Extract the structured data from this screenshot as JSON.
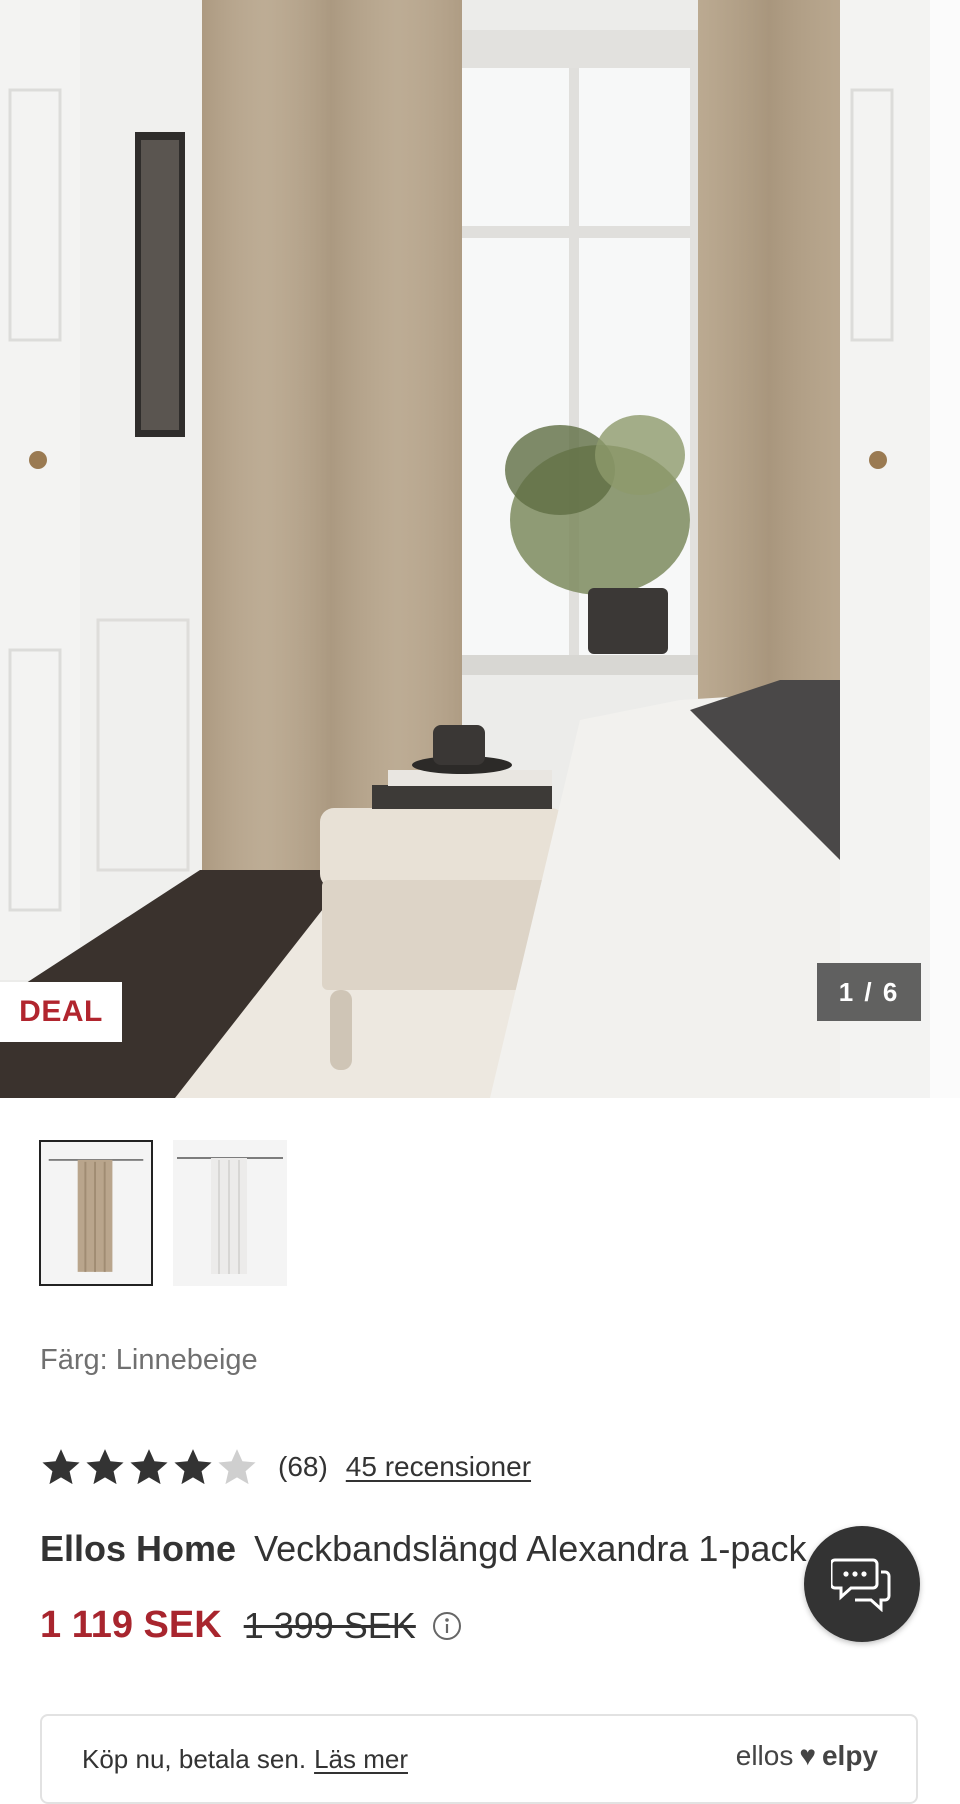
{
  "hero": {
    "badge": "DEAL",
    "counter": "1 / 6",
    "image_alt": "Bedroom with linen beige curtains"
  },
  "thumbnails": [
    {
      "color": "#b9a58c",
      "selected": true
    },
    {
      "color": "#ecebea",
      "selected": false
    }
  ],
  "color_line": "Färg: Linnebeige",
  "rating": {
    "stars": 4,
    "max": 5,
    "count": "(68)",
    "reviews_link": "45 recensioner"
  },
  "product": {
    "brand": "Ellos Home",
    "name": "Veckbandslängd Alexandra 1-pack"
  },
  "price": {
    "current": "1 119 SEK",
    "original": "1 399 SEK"
  },
  "pay_later": {
    "text": "Köp nu, betala sen.",
    "link": "Läs mer",
    "logo_left": "ellos",
    "logo_right": "elpy"
  },
  "colors": {
    "sale": "#a8252e",
    "chat_bg": "#333333"
  }
}
